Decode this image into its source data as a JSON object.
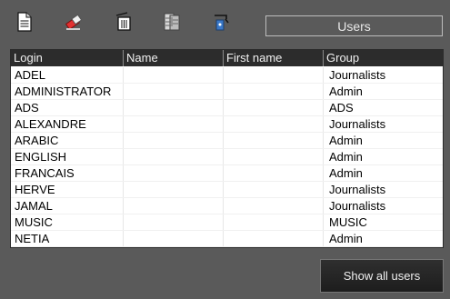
{
  "toolbar": {
    "icons": [
      "new-document-icon",
      "delete-eraser-icon",
      "trash-bin-icon",
      "database-icon",
      "tools-icon"
    ],
    "title": "Users"
  },
  "grid": {
    "columns": [
      "Login",
      "Name",
      "First name",
      "Group"
    ],
    "rows": [
      [
        "ADEL",
        "",
        "",
        "Journalists"
      ],
      [
        "ADMINISTRATOR",
        "",
        "",
        "Admin"
      ],
      [
        "ADS",
        "",
        "",
        "ADS"
      ],
      [
        "ALEXANDRE",
        "",
        "",
        "Journalists"
      ],
      [
        "ARABIC",
        "",
        "",
        "Admin"
      ],
      [
        "ENGLISH",
        "",
        "",
        "Admin"
      ],
      [
        "FRANCAIS",
        "",
        "",
        "Admin"
      ],
      [
        "HERVE",
        "",
        "",
        "Journalists"
      ],
      [
        "JAMAL",
        "",
        "",
        "Journalists"
      ],
      [
        "MUSIC",
        "",
        "",
        "MUSIC"
      ],
      [
        "NETIA",
        "",
        "",
        "Admin"
      ]
    ]
  },
  "footer": {
    "show_all_label": "Show all users"
  }
}
